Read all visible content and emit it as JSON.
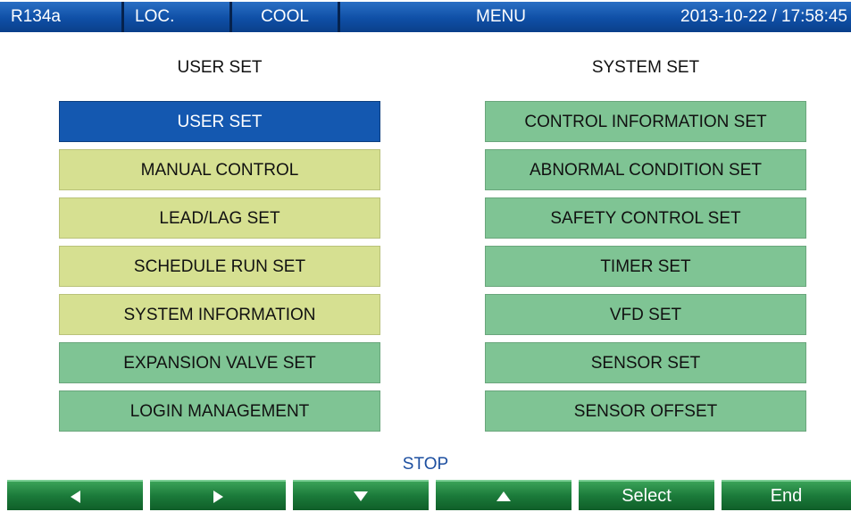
{
  "topbar": {
    "refrigerant": "R134a",
    "location": "LOC.",
    "mode": "COOL",
    "screen": "MENU",
    "datetime": "2013-10-22 / 17:58:45"
  },
  "user_set": {
    "title": "USER SET",
    "items": [
      {
        "label": "USER SET"
      },
      {
        "label": "MANUAL CONTROL"
      },
      {
        "label": "LEAD/LAG SET"
      },
      {
        "label": "SCHEDULE RUN SET"
      },
      {
        "label": "SYSTEM INFORMATION"
      },
      {
        "label": "EXPANSION VALVE SET"
      },
      {
        "label": "LOGIN MANAGEMENT"
      }
    ]
  },
  "system_set": {
    "title": "SYSTEM SET",
    "items": [
      {
        "label": "CONTROL INFORMATION SET"
      },
      {
        "label": "ABNORMAL CONDITION SET"
      },
      {
        "label": "SAFETY CONTROL SET"
      },
      {
        "label": "TIMER SET"
      },
      {
        "label": "VFD SET"
      },
      {
        "label": "SENSOR SET"
      },
      {
        "label": "SENSOR OFFSET"
      }
    ]
  },
  "status": "STOP",
  "nav": {
    "left_icon": "arrow-left-icon",
    "right_icon": "arrow-right-icon",
    "down_icon": "arrow-down-icon",
    "up_icon": "arrow-up-icon",
    "select_label": "Select",
    "end_label": "End"
  },
  "colors": {
    "header_blue": "#0f4fa6",
    "active_blue": "#1458b0",
    "yellow_button": "#d6e091",
    "green_button": "#7fc494",
    "nav_green": "#1b7a3a",
    "status_text": "#1d4fa0"
  }
}
